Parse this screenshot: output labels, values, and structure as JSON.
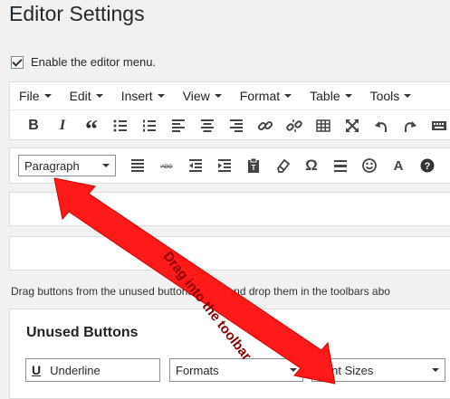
{
  "title": "Editor Settings",
  "enable_label": "Enable the editor menu.",
  "menu": [
    "File",
    "Edit",
    "Insert",
    "View",
    "Format",
    "Table",
    "Tools"
  ],
  "toolbar1": [
    {
      "icon": "bold-icon"
    },
    {
      "icon": "italic-icon"
    },
    {
      "icon": "blockquote-icon"
    },
    {
      "icon": "bullet-list-icon"
    },
    {
      "icon": "numbered-list-icon"
    },
    {
      "icon": "align-left-icon"
    },
    {
      "icon": "align-center-icon"
    },
    {
      "icon": "align-right-icon"
    },
    {
      "icon": "link-icon"
    },
    {
      "icon": "unlink-icon"
    },
    {
      "icon": "table-icon"
    },
    {
      "icon": "fullscreen-icon"
    },
    {
      "icon": "undo-icon"
    },
    {
      "icon": "redo-icon"
    },
    {
      "icon": "keyboard-icon"
    }
  ],
  "toolbar2": {
    "paragraph_select": "Paragraph",
    "buttons": [
      "justify-icon",
      "strikethrough-icon",
      "outdent-icon",
      "indent-icon",
      "paste-text-icon",
      "clear-formatting-icon",
      "omega-icon",
      "horizontal-rule-icon",
      "emoticon-icon",
      "text-color-icon",
      "help-icon"
    ]
  },
  "blockquote_glyph": "“",
  "omega_glyph": "Ω",
  "text_color_glyph": "A",
  "help_text": "Drag buttons from the unused buttons below and drop them in the toolbars abo",
  "unused": {
    "title": "Unused Buttons",
    "underline_icon": "U",
    "underline_label": "Underline",
    "formats_label": "Formats",
    "font_sizes_label": "Font Sizes"
  },
  "annotation": "Drag into the toolbar",
  "colors": {
    "arrow": "#ff0000",
    "annotation_text": "#8b0000"
  }
}
